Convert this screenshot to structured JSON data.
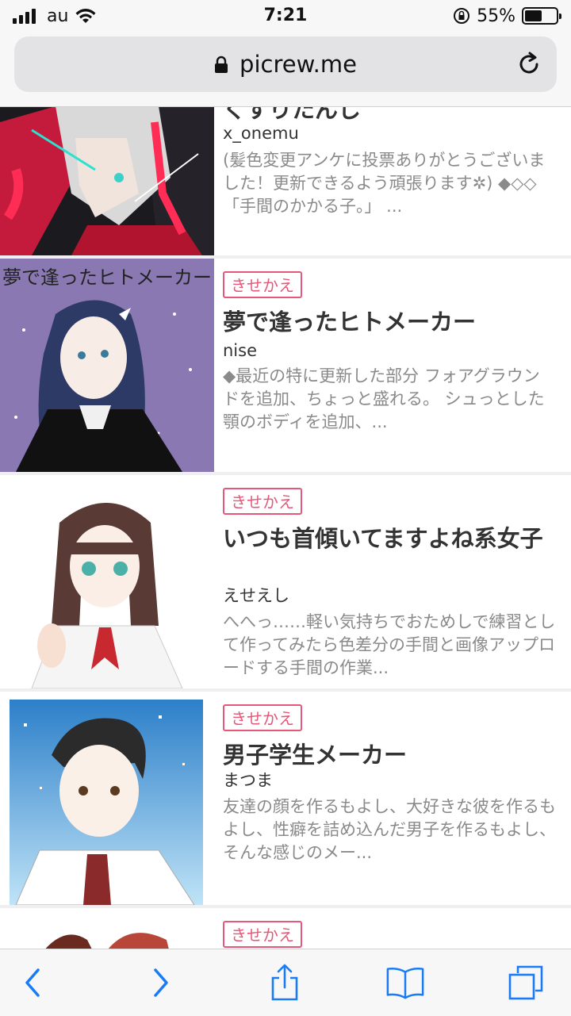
{
  "status_bar": {
    "carrier": "au",
    "time": "7:21",
    "battery_percent_text": "55%",
    "battery_level": 0.55
  },
  "browser": {
    "url": "picrew.me"
  },
  "items": [
    {
      "tag": "",
      "title": "くすりたんし",
      "author": "x_onemu",
      "description": "(髪色変更アンケに投票ありがとうございました！更新できるよう頑張ります✲) ◆◇◇「手間のかかる子。」 ..."
    },
    {
      "tag": "きせかえ",
      "title": "夢で逢ったヒトメーカー",
      "author": "nise",
      "description": "◆最近の特に更新した部分 フォアグラウンドを追加、ちょっと盛れる。 シュっとした顎のボディを追加、..."
    },
    {
      "tag": "きせかえ",
      "title": "いつも首傾いてますよね系女子",
      "author": "えせえし",
      "description": "へへっ……軽い気持ちでおためしで練習として作ってみたら色差分の手間と画像アップロードする手間の作業..."
    },
    {
      "tag": "きせかえ",
      "title": "男子学生メーカー",
      "author": "まつま",
      "description": "友達の顔を作るもよし、大好きな彼を作るもよし、性癖を詰め込んだ男子を作るもよし、そんな感じのメー..."
    },
    {
      "tag": "きせかえ",
      "title": "",
      "author": "",
      "description": ""
    }
  ],
  "thumb_texts": {
    "item2_overlay": "夢で逢ったヒトメーカー"
  },
  "icons": {
    "back": "chevron-left-icon",
    "forward": "chevron-right-icon",
    "share": "share-icon",
    "bookmarks": "book-icon",
    "tabs": "tabs-icon"
  },
  "colors": {
    "accent": "#e4587a",
    "ios_blue": "#1a7cf5"
  }
}
